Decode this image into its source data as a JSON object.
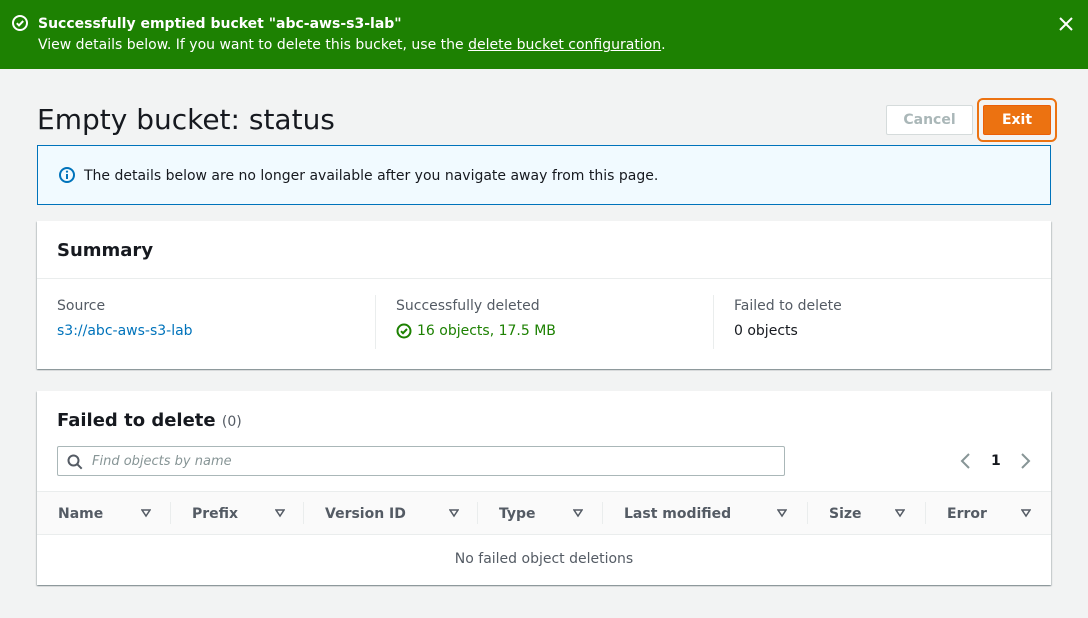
{
  "flash": {
    "title": "Successfully emptied bucket \"abc-aws-s3-lab\"",
    "body_prefix": "View details below. If you want to delete this bucket, use the",
    "link": "delete bucket configuration",
    "body_suffix": ".",
    "icon": "check-circle-icon",
    "close_icon": "close-icon",
    "color": "#1d8102"
  },
  "header": {
    "title": "Empty bucket: status",
    "cancel_label": "Cancel",
    "exit_label": "Exit"
  },
  "info": {
    "icon": "info-icon",
    "text": "The details below are no longer available after you navigate away from this page."
  },
  "summary": {
    "title": "Summary",
    "source_label": "Source",
    "source_value": "s3://abc-aws-s3-lab",
    "deleted_label": "Successfully deleted",
    "deleted_value": "16 objects, 17.5 MB",
    "failed_label": "Failed to delete",
    "failed_value": "0 objects"
  },
  "failed": {
    "title": "Failed to delete",
    "count": "(0)",
    "search_placeholder": "Find objects by name",
    "page": "1",
    "columns": [
      "Name",
      "Prefix",
      "Version ID",
      "Type",
      "Last modified",
      "Size",
      "Error"
    ],
    "empty_text": "No failed object deletions"
  },
  "colors": {
    "accent": "#ec7211",
    "link": "#0073bb",
    "success": "#1d8102"
  }
}
